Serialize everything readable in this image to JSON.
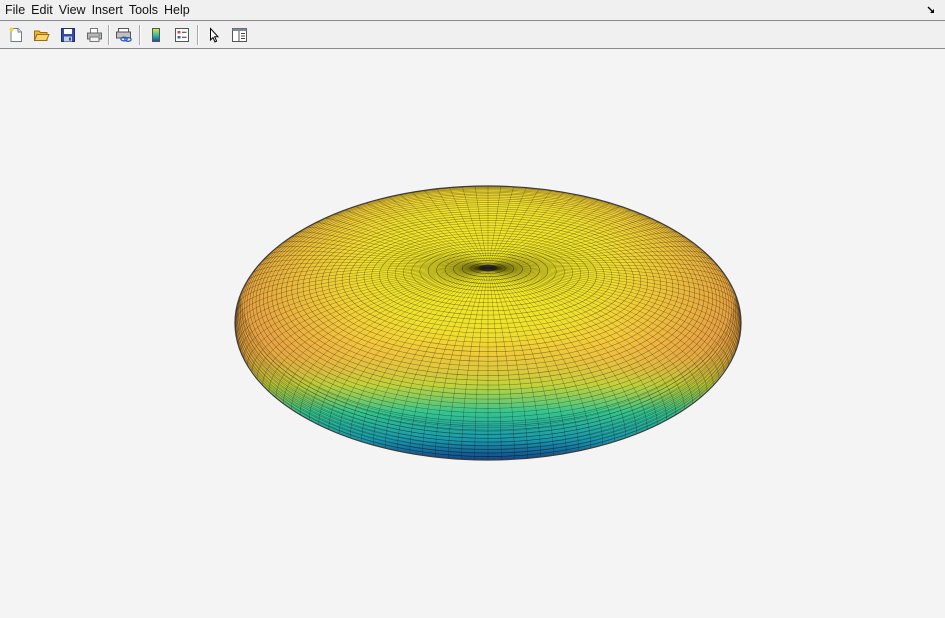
{
  "menubar": {
    "items": [
      "File",
      "Edit",
      "View",
      "Insert",
      "Tools",
      "Help"
    ],
    "dock_icon": "dock-arrow-icon"
  },
  "toolbar": {
    "buttons": [
      {
        "name": "new-figure",
        "icon": "new-document-icon"
      },
      {
        "name": "open-file",
        "icon": "open-folder-icon"
      },
      {
        "name": "save-figure",
        "icon": "save-disk-icon"
      },
      {
        "name": "print-figure",
        "icon": "printer-icon"
      },
      {
        "name": "link-plot",
        "icon": "link-plot-icon"
      },
      {
        "name": "insert-colorbar",
        "icon": "colorbar-icon"
      },
      {
        "name": "insert-legend",
        "icon": "legend-icon"
      },
      {
        "name": "edit-plot",
        "icon": "pointer-arrow-icon"
      },
      {
        "name": "open-property-inspector",
        "icon": "property-inspector-icon"
      }
    ]
  },
  "figure": {
    "surface": "oblate-spheroid",
    "colormap": [
      "#0e3f8a",
      "#1f9ea5",
      "#30c88e",
      "#a8dd3c",
      "#f0ea2a",
      "#f6b443"
    ],
    "edge_color": "#000000",
    "background": "#f4f4f4"
  }
}
